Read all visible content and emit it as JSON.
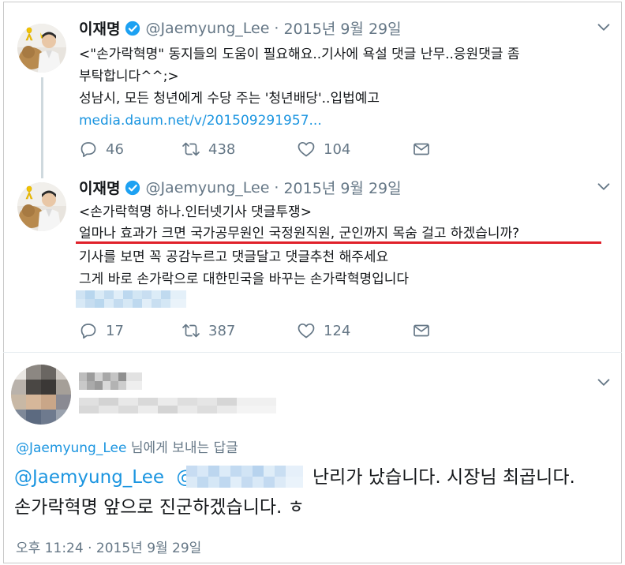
{
  "tweets": [
    {
      "name": "이재명",
      "handle": "@Jaemyung_Lee",
      "separator": "·",
      "date": "2015년 9월 29일",
      "lines": [
        "<\"손가락혁명\" 동지들의 도움이 필요해요..기사에 욕설 댓글 난무..응원댓글 좀",
        "부탁합니다^^;>",
        "성남시, 모든 청년에게 수당 주는 '청년배당'..입법예고"
      ],
      "link": "media.daum.net/v/201509291957...",
      "replies": "46",
      "retweets": "438",
      "likes": "104"
    },
    {
      "name": "이재명",
      "handle": "@Jaemyung_Lee",
      "separator": "·",
      "date": "2015년 9월 29일",
      "lines": [
        "<손가락혁명 하나.인터넷기사 댓글투쟁>",
        "얼마나 효과가 크면 국가공무원인 국정원직원, 군인까지 목숨 걸고 하겠습니까?",
        "기사를 보면 꼭 공감누르고 댓글달고 댓글추천 해주세요",
        "그게 바로 손가락으로 대한민국을 바꾸는 손가락혁명입니다"
      ],
      "replies": "17",
      "retweets": "387",
      "likes": "124"
    }
  ],
  "reply": {
    "to_handle": "@Jaemyung_Lee",
    "to_suffix": "님에게 보내는 답글",
    "mention": "@Jaemyung_Lee",
    "mention2": "@",
    "text_line1_rest": "난리가 났습니다. 시장님 최곱니다.",
    "text_line2": "손가락혁명 앞으로 진군하겠습니다. ㅎ",
    "time": "오후 11:24 · 2015년 9월 29일"
  },
  "colors": {
    "accent": "#1b95e0",
    "secondary_text": "#657786",
    "underline": "#e0202a",
    "verified": "#1da1f2"
  },
  "icons": [
    "reply-icon",
    "retweet-icon",
    "like-icon",
    "message-icon",
    "verified-icon",
    "chevron-down-icon",
    "yellow-ribbon-icon"
  ]
}
